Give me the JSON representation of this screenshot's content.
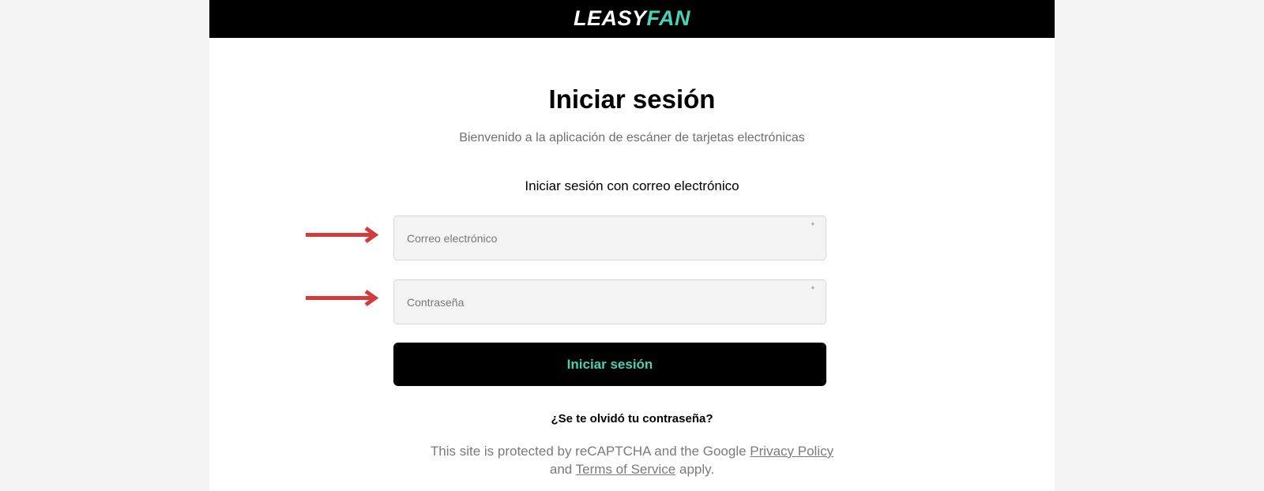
{
  "header": {
    "logo_part1": "LEASY",
    "logo_part2": "FAN"
  },
  "main": {
    "title": "Iniciar sesión",
    "subtitle": "Bienvenido a la aplicación de escáner de tarjetas electrónicas",
    "section_label": "Iniciar sesión con correo electrónico"
  },
  "form": {
    "email": {
      "placeholder": "Correo electrónico",
      "value": "",
      "required_marker": "*"
    },
    "password": {
      "placeholder": "Contraseña",
      "value": "",
      "required_marker": "*"
    },
    "submit_label": "Iniciar sesión",
    "forgot_label": "¿Se te olvidó tu contraseña?"
  },
  "recaptcha": {
    "text1": "This site is protected by reCAPTCHA and the Google ",
    "privacy_link": "Privacy Policy",
    "text2": "and ",
    "terms_link": "Terms of Service",
    "text3": " apply."
  },
  "colors": {
    "brand_accent": "#45d2b7",
    "topbar": "#000000",
    "annotation_arrow": "#d23c3c"
  }
}
